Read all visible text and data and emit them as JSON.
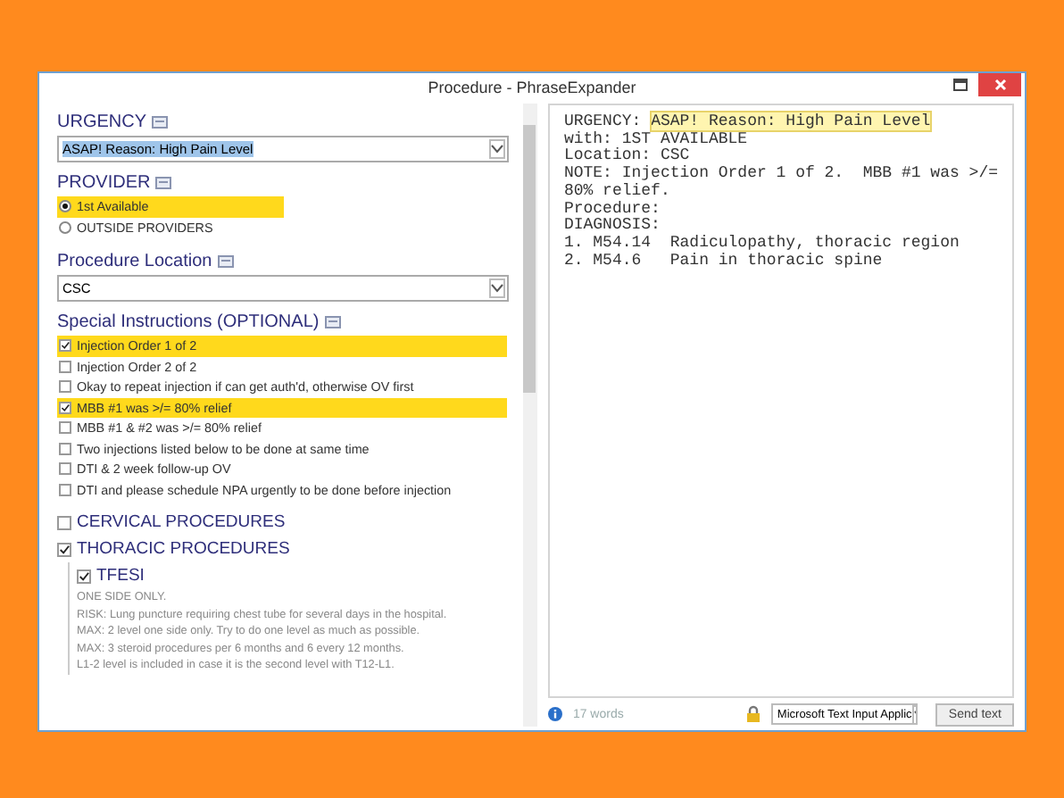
{
  "window": {
    "title": "Procedure - PhraseExpander"
  },
  "urgency": {
    "title": "URGENCY",
    "value": "ASAP! Reason: High Pain Level"
  },
  "provider": {
    "title": "PROVIDER",
    "options": [
      {
        "label": "1st Available",
        "selected": true
      },
      {
        "label": "OUTSIDE PROVIDERS",
        "selected": false
      }
    ]
  },
  "location": {
    "title": "Procedure Location",
    "value": "CSC"
  },
  "special": {
    "title": "Special Instructions (OPTIONAL)",
    "items": [
      {
        "label": "Injection Order 1 of 2",
        "checked": true
      },
      {
        "label": "Injection Order 2 of 2",
        "checked": false
      },
      {
        "label": "Okay to repeat injection if can get auth'd, otherwise OV first",
        "checked": false
      },
      {
        "label": "MBB #1 was >/= 80% relief",
        "checked": true
      },
      {
        "label": "MBB #1 & #2 was >/= 80% relief",
        "checked": false
      },
      {
        "label": "Two injections listed below to be done at same time",
        "checked": false
      },
      {
        "label": "DTI & 2 week follow-up OV",
        "checked": false
      },
      {
        "label": "DTI and please schedule NPA urgently to be done before injection",
        "checked": false
      }
    ]
  },
  "procedures": [
    {
      "label": "CERVICAL PROCEDURES",
      "checked": false
    },
    {
      "label": "THORACIC PROCEDURES",
      "checked": true,
      "children": [
        {
          "label": "TFESI",
          "checked": true,
          "notes": [
            "ONE SIDE ONLY.",
            "RISK: Lung puncture requiring chest tube for several days in the hospital.",
            "MAX: 2 level one side only. Try to do one level as much as possible.",
            "MAX: 3 steroid procedures per 6 months and 6 every 12 months.",
            "L1-2 level is included in case it is the second level with T12-L1."
          ]
        }
      ]
    }
  ],
  "preview": {
    "lines": [
      {
        "text": "URGENCY: ",
        "highlight": "ASAP! Reason: High Pain Level"
      },
      {
        "text": "with: 1ST AVAILABLE"
      },
      {
        "text": "Location: CSC"
      },
      {
        "text": "NOTE: Injection Order 1 of 2.  MBB #1 was >/="
      },
      {
        "text": "80% relief."
      },
      {
        "text": "Procedure:"
      },
      {
        "text": "DIAGNOSIS:"
      },
      {
        "text": "1. M54.14  Radiculopathy, thoracic region"
      },
      {
        "text": "2. M54.6   Pain in thoracic spine"
      }
    ]
  },
  "footer": {
    "word_count": "17 words",
    "input_method": "Microsoft Text Input Applic",
    "send_button": "Send text"
  }
}
